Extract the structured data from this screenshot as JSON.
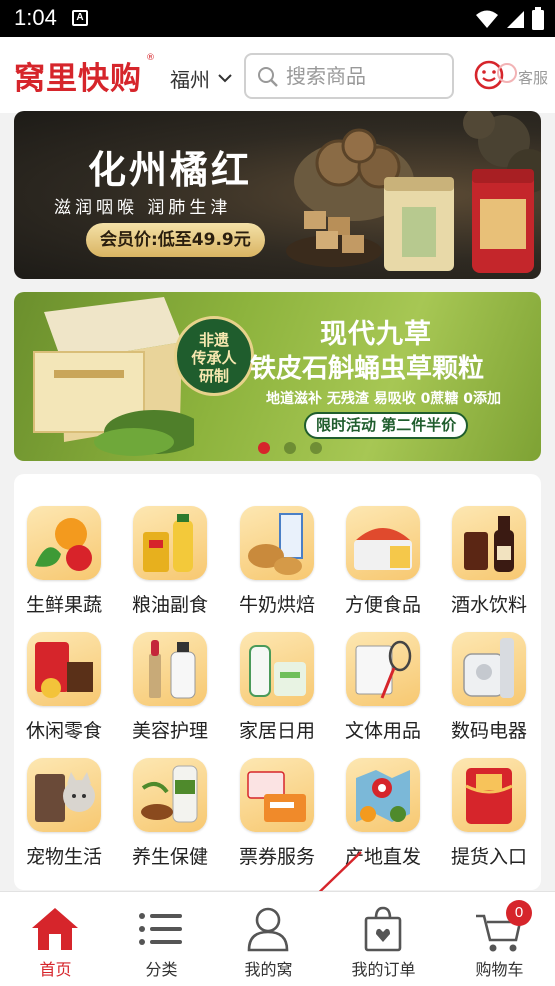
{
  "status_bar": {
    "time": "1:04",
    "notif_glyph": "A"
  },
  "header": {
    "logo": "窝里快购",
    "logo_reg": "®",
    "city": "福州",
    "search_placeholder": "搜索商品",
    "service_label": "客服"
  },
  "banner1": {
    "title": "化州橘红",
    "subtitle": "滋润咽喉   润肺生津",
    "price_tag": "会员价:低至49.9元"
  },
  "banner2": {
    "badge": "非遗传承人研制",
    "badge_lines": [
      "非遗",
      "传承人",
      "研制"
    ],
    "title1": "现代九草",
    "title2": "铁皮石斛蛹虫草颗粒",
    "sub": "地道滋补 无残渣 易吸收 0蔗糖 0添加",
    "pill": "限时活动 第二件半价"
  },
  "carousel": {
    "count": 3,
    "active_index": 0
  },
  "categories": [
    {
      "label": "生鲜果蔬",
      "icon": "fresh-produce-icon"
    },
    {
      "label": "粮油副食",
      "icon": "grain-oil-icon"
    },
    {
      "label": "牛奶烘焙",
      "icon": "milk-bakery-icon"
    },
    {
      "label": "方便食品",
      "icon": "instant-food-icon"
    },
    {
      "label": "酒水饮料",
      "icon": "drinks-icon"
    },
    {
      "label": "休闲零食",
      "icon": "snacks-icon"
    },
    {
      "label": "美容护理",
      "icon": "beauty-care-icon"
    },
    {
      "label": "家居日用",
      "icon": "household-icon"
    },
    {
      "label": "文体用品",
      "icon": "stationery-sports-icon"
    },
    {
      "label": "数码电器",
      "icon": "electronics-icon"
    },
    {
      "label": "宠物生活",
      "icon": "pet-icon"
    },
    {
      "label": "养生保健",
      "icon": "health-icon"
    },
    {
      "label": "票券服务",
      "icon": "ticket-icon"
    },
    {
      "label": "产地直发",
      "icon": "origin-direct-icon"
    },
    {
      "label": "提货入口",
      "icon": "pickup-coupon-icon"
    }
  ],
  "bottom_nav": {
    "home": "首页",
    "category": "分类",
    "mine": "我的窝",
    "orders": "我的订单",
    "cart": "购物车",
    "cart_count": "0"
  },
  "colors": {
    "brand": "#d6252b",
    "text": "#222222",
    "bg": "#f2f2f2"
  }
}
